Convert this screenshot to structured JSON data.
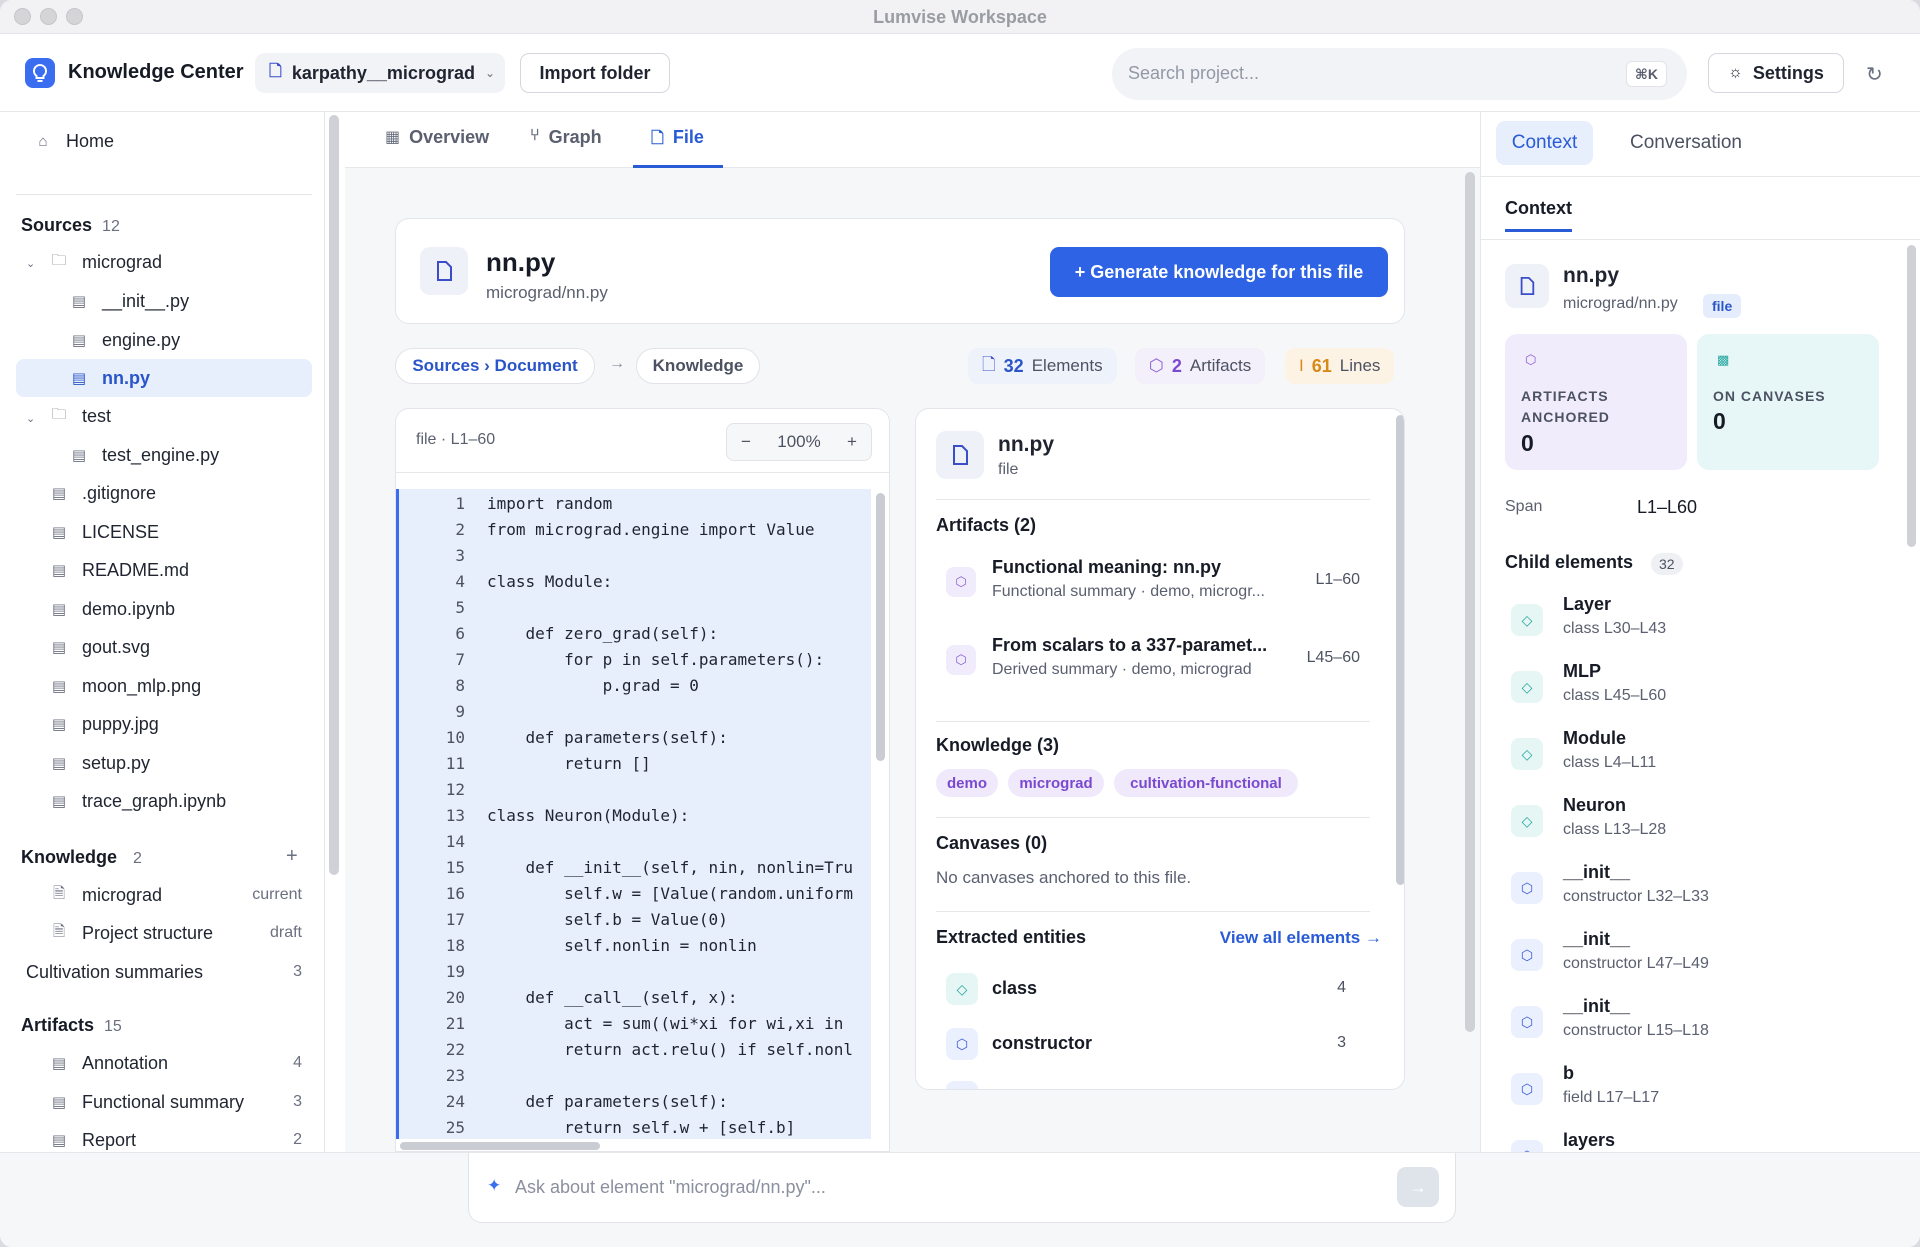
{
  "window": {
    "title": "Lumvise Workspace"
  },
  "header": {
    "brand": "Knowledge Center",
    "repo": "karpathy__micrograd",
    "import_label": "Import folder",
    "search_placeholder": "Search project...",
    "search_shortcut": "⌘K",
    "settings_label": "Settings"
  },
  "sidebar": {
    "home": "Home",
    "sources_label": "Sources",
    "sources_count": "12",
    "folder_micrograd": "micrograd",
    "f_init": "__init__.py",
    "f_engine": "engine.py",
    "f_nn": "nn.py",
    "folder_test": "test",
    "f_test_engine": "test_engine.py",
    "f_gitignore": ".gitignore",
    "f_license": "LICENSE",
    "f_readme": "README.md",
    "f_demo": "demo.ipynb",
    "f_gout": "gout.svg",
    "f_moon": "moon_mlp.png",
    "f_puppy": "puppy.jpg",
    "f_setup": "setup.py",
    "f_trace": "trace_graph.ipynb",
    "knowledge_label": "Knowledge",
    "knowledge_count": "2",
    "k_micrograd": "micrograd",
    "k_micrograd_state": "current",
    "k_structure": "Project structure",
    "k_structure_state": "draft",
    "cultivation": "Cultivation summaries",
    "cultivation_count": "3",
    "artifacts_label": "Artifacts",
    "artifacts_count": "15",
    "a_annotation": "Annotation",
    "a_annotation_count": "4",
    "a_functional": "Functional summary",
    "a_functional_count": "3",
    "a_report": "Report",
    "a_report_count": "2"
  },
  "tabs": {
    "overview": "Overview",
    "graph": "Graph",
    "file": "File"
  },
  "file_card": {
    "name": "nn.py",
    "path": "micrograd/nn.py",
    "generate_label": "+ Generate knowledge for this file"
  },
  "crumbs": {
    "sources": "Sources › Document",
    "knowledge": "Knowledge",
    "elements_count": "32",
    "elements_label": "Elements",
    "artifacts_count": "2",
    "artifacts_label": "Artifacts",
    "lines_count": "61",
    "lines_label": "Lines"
  },
  "code": {
    "label": "file · L1–60",
    "zoom": "100%",
    "zoom_minus": "−",
    "zoom_plus": "+",
    "lines": [
      "import random",
      "from micrograd.engine import Value",
      "",
      "class Module:",
      "",
      "    def zero_grad(self):",
      "        for p in self.parameters():",
      "            p.grad = 0",
      "",
      "    def parameters(self):",
      "        return []",
      "",
      "class Neuron(Module):",
      "",
      "    def __init__(self, nin, nonlin=Tru",
      "        self.w = [Value(random.uniform",
      "        self.b = Value(0)",
      "        self.nonlin = nonlin",
      "",
      "    def __call__(self, x):",
      "        act = sum((wi*xi for wi,xi in",
      "        return act.relu() if self.nonl",
      "",
      "    def parameters(self):",
      "        return self.w + [self.b]"
    ]
  },
  "detail": {
    "name": "nn.py",
    "type": "file",
    "artifacts_heading": "Artifacts (2)",
    "artifacts": [
      {
        "title": "Functional meaning: nn.py",
        "sub": "Functional summary · demo, microgr...",
        "range": "L1–60"
      },
      {
        "title": "From scalars to a 337-paramet...",
        "sub": "Derived summary · demo, micrograd",
        "range": "L45–60"
      }
    ],
    "knowledge_heading": "Knowledge (3)",
    "tags": [
      "demo",
      "micrograd",
      "cultivation-functional"
    ],
    "canvases_heading": "Canvases (0)",
    "canvases_empty": "No canvases anchored to this file.",
    "entities_heading": "Extracted entities",
    "view_all": "View all elements →",
    "entities": [
      {
        "name": "class",
        "count": "4"
      },
      {
        "name": "constructor",
        "count": "3"
      }
    ]
  },
  "right": {
    "tab_context": "Context",
    "tab_conversation": "Conversation",
    "sub_context": "Context",
    "name": "nn.py",
    "path": "micrograd/nn.py",
    "badge": "file",
    "kpi_artifacts_label": "ARTIFACTS ANCHORED",
    "kpi_artifacts_value": "0",
    "kpi_canvases_label": "ON CANVASES",
    "kpi_canvases_value": "0",
    "span_label": "Span",
    "span_value": "L1–L60",
    "children_heading": "Child elements",
    "children_count": "32",
    "children": [
      {
        "name": "Layer",
        "sub": "class L30–L43"
      },
      {
        "name": "MLP",
        "sub": "class L45–L60"
      },
      {
        "name": "Module",
        "sub": "class L4–L11"
      },
      {
        "name": "Neuron",
        "sub": "class L13–L28"
      },
      {
        "name": "__init__",
        "sub": "constructor L32–L33"
      },
      {
        "name": "__init__",
        "sub": "constructor L47–L49"
      },
      {
        "name": "__init__",
        "sub": "constructor L15–L18"
      },
      {
        "name": "b",
        "sub": "field L17–L17"
      },
      {
        "name": "layers",
        "sub": ""
      }
    ]
  },
  "ask": {
    "placeholder": "Ask about element \"micrograd/nn.py\"..."
  },
  "colors": {
    "accent": "#2d63e4",
    "artifact": "#8a5cd6",
    "class": "#23a6a0",
    "highlight": "#e8effc"
  }
}
